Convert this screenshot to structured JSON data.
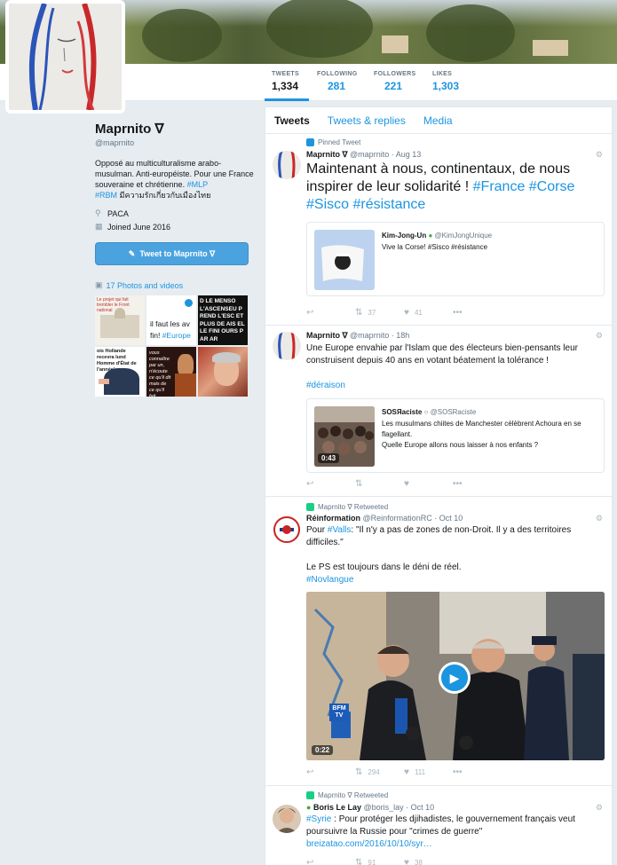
{
  "profile": {
    "name": "Maprnito ∇",
    "handle": "@maprnito",
    "bio_plain": "Opposé au multiculturalisme arabo-musulman. Anti-européiste. Pour une France souveraine et chrétienne. ",
    "bio_tag1": "#MLP",
    "bio_tag2": "#RBM",
    "bio_tail": " มีความรักเกี่ยวกับเมืองไทย",
    "location": "PACA",
    "joined": "Joined June 2016",
    "tweet_to_label": "Tweet to Maprnito ∇",
    "photos_label": "17 Photos and videos",
    "photo_texts": {
      "p1": "Le projet qui fait trembler le Front national",
      "p2_line1": "il faut les av",
      "p2_line2": "fin! ",
      "p2_tag": "#Europe",
      "p3": "D LE MENSO L'ASCENSEU PREND L'ESC ET PLUS DE AIS ELLE FINI OURS PAR AR",
      "p4": "ois Hollande recevra lund Homme d'État de l'année'",
      "p5": "vous connaître par un, n'écoute ce qu'il dit mais de ce qu'il fait."
    }
  },
  "stats": [
    {
      "label": "TWEETS",
      "value": "1,334"
    },
    {
      "label": "FOLLOWING",
      "value": "281"
    },
    {
      "label": "FOLLOWERS",
      "value": "221"
    },
    {
      "label": "LIKES",
      "value": "1,303"
    }
  ],
  "tabs": [
    "Tweets",
    "Tweets & replies",
    "Media"
  ],
  "tweets": [
    {
      "context": "Pinned Tweet",
      "name": "Maprnito ∇",
      "handle": "@maprnito · Aug 13",
      "text_plain": "Maintenant à nous, continentaux, de nous inspirer de leur solidarité ! ",
      "tags": "#France #Corse #Sisco #résistance",
      "quote": {
        "name": "Kim-Jong-Un",
        "handle": "@KimJongUnique",
        "text": "Vive la Corse! #Sisco #résistance"
      },
      "retweets": "37",
      "likes": "41"
    },
    {
      "name": "Maprnito ∇",
      "handle": "@maprnito · 18h",
      "text_plain": "Une Europe envahie par l'Islam que des électeurs bien-pensants leur construisent depuis 40 ans en votant béatement la tolérance !",
      "tag": "#déraison",
      "quote": {
        "name": "SOSЯaciste",
        "handle": "@SOSRaciste",
        "text_line1": "Les musulmans chiites de Manchester célèbrent Achoura en se flagellant.",
        "text_line2": "Quelle Europe allons nous laisser à nos enfants ?",
        "duration": "0:43"
      }
    },
    {
      "context": "Maprnito ∇ Retweeted",
      "name": "Réinformation",
      "handle": "@ReinformationRC · Oct 10",
      "text_pre": "Pour ",
      "text_tag": "#Valls",
      "text_post": ": \"Il n'y a pas de zones de non-Droit. Il y a des territoires difficiles.\"",
      "text_line2": "Le PS est toujours dans le déni de réel.",
      "tag2": "#Novlangue",
      "video_duration": "0:22",
      "video_badge": "BFM TV",
      "retweets": "294",
      "likes": "111"
    },
    {
      "context": "Maprnito ∇ Retweeted",
      "name": "Boris Le Lay",
      "handle": "@boris_lay · Oct 10",
      "text_tag": "#Syrie",
      "text_post": " : Pour protéger les djihadistes, le gouvernement français veut poursuivre la Russie pour \"crimes de guerre\"",
      "link": "breizatao.com/2016/10/10/syr…",
      "retweets": "91",
      "likes": "38"
    }
  ]
}
